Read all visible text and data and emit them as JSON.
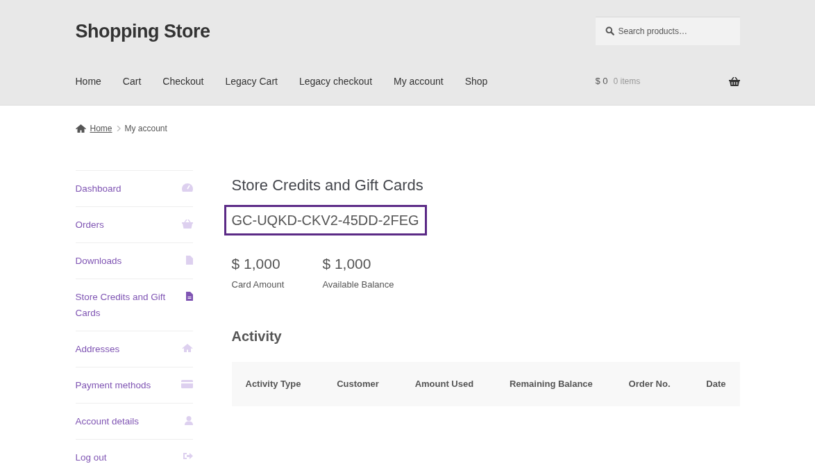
{
  "site_title": "Shopping Store",
  "search": {
    "placeholder": "Search products…"
  },
  "nav": [
    "Home",
    "Cart",
    "Checkout",
    "Legacy Cart",
    "Legacy checkout",
    "My account",
    "Shop"
  ],
  "cart": {
    "total": "$ 0",
    "count": "0 items"
  },
  "breadcrumb": {
    "home": "Home",
    "current": "My account"
  },
  "sidebar": {
    "items": [
      {
        "label": "Dashboard",
        "selected": false
      },
      {
        "label": "Orders",
        "selected": false
      },
      {
        "label": "Downloads",
        "selected": false
      },
      {
        "label": "Store Credits and Gift Cards",
        "selected": true
      },
      {
        "label": "Addresses",
        "selected": false
      },
      {
        "label": "Payment methods",
        "selected": false
      },
      {
        "label": "Account details",
        "selected": false
      },
      {
        "label": "Log out",
        "selected": false
      }
    ]
  },
  "page_title": "Store Credits and Gift Cards",
  "card_code": "GC-UQKD-CKV2-45DD-2FEG",
  "amounts": [
    {
      "value": "$ 1,000",
      "label": "Card Amount"
    },
    {
      "value": "$ 1,000",
      "label": "Available Balance"
    }
  ],
  "activity": {
    "title": "Activity",
    "columns": [
      "Activity Type",
      "Customer",
      "Amount Used",
      "Remaining Balance",
      "Order No.",
      "Date"
    ]
  }
}
